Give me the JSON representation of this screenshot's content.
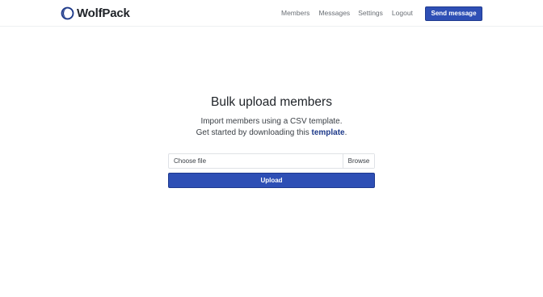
{
  "navbar": {
    "brand": "WolfPack",
    "links": {
      "members": "Members",
      "messages": "Messages",
      "settings": "Settings",
      "logout": "Logout"
    },
    "send_message": "Send message"
  },
  "main": {
    "title": "Bulk upload members",
    "subtitle_line1": "Import members using a CSV template.",
    "subtitle_line2_prefix": "Get started by downloading this ",
    "template_link": "template",
    "subtitle_line2_suffix": ".",
    "file_input": {
      "label": "Choose file",
      "browse": "Browse"
    },
    "upload_button": "Upload"
  },
  "colors": {
    "accent": "#2e4fb5",
    "link": "#1e3a8a",
    "text": "#1f2328",
    "muted": "#6a6f75"
  },
  "icons": {
    "logo": "wolfpack-logo-icon"
  }
}
